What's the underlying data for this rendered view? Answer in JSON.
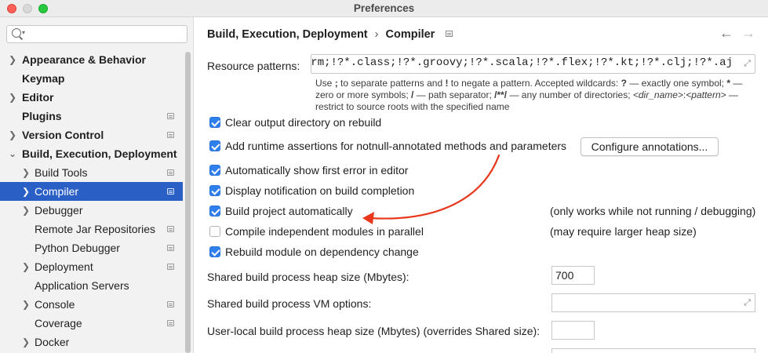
{
  "window": {
    "title": "Preferences"
  },
  "search": {
    "placeholder": "",
    "value": ""
  },
  "sidebar": {
    "items": [
      {
        "label": "Appearance & Behavior"
      },
      {
        "label": "Keymap"
      },
      {
        "label": "Editor"
      },
      {
        "label": "Plugins"
      },
      {
        "label": "Version Control"
      },
      {
        "label": "Build, Execution, Deployment"
      },
      {
        "label": "Build Tools"
      },
      {
        "label": "Compiler"
      },
      {
        "label": "Debugger"
      },
      {
        "label": "Remote Jar Repositories"
      },
      {
        "label": "Python Debugger"
      },
      {
        "label": "Deployment"
      },
      {
        "label": "Application Servers"
      },
      {
        "label": "Console"
      },
      {
        "label": "Coverage"
      },
      {
        "label": "Docker"
      }
    ]
  },
  "breadcrumb": {
    "parent": "Build, Execution, Deployment",
    "separator": "›",
    "current": "Compiler"
  },
  "nav": {
    "back": "←",
    "forward": "→"
  },
  "resource_patterns": {
    "label": "Resource patterns:",
    "value": "!?*.java;!?*.form;!?*.class;!?*.groovy;!?*.scala;!?*.flex;!?*.kt;!?*.clj;!?*.aj",
    "help": {
      "t1": "Use ",
      "b1": ";",
      "t2": " to separate patterns and ",
      "b2": "!",
      "t3": " to negate a pattern. Accepted wildcards: ",
      "b3": "?",
      "t4": " — exactly one symbol; ",
      "b4": "*",
      "t5": " — zero or more symbols; ",
      "b5": "/",
      "t6": " — path separator; ",
      "b6": "/**/",
      "t7": " — any number of directories; ",
      "i1": "<dir_name>",
      "t8": ":",
      "i2": "<pattern>",
      "t9": " — restrict to source roots with the specified name"
    }
  },
  "options": {
    "clear_output": {
      "label": "Clear output directory on rebuild",
      "checked": true
    },
    "runtime_assertions": {
      "label": "Add runtime assertions for notnull-annotated methods and parameters",
      "checked": true
    },
    "configure_button": "Configure annotations...",
    "show_first_error": {
      "label": "Automatically show first error in editor",
      "checked": true
    },
    "display_notification": {
      "label": "Display notification on build completion",
      "checked": true
    },
    "build_auto": {
      "label": "Build project automatically",
      "checked": true,
      "note": "(only works while not running / debugging)"
    },
    "compile_parallel": {
      "label": "Compile independent modules in parallel",
      "checked": false,
      "note": "(may require larger heap size)"
    },
    "rebuild_module": {
      "label": "Rebuild module on dependency change",
      "checked": true
    }
  },
  "heap": {
    "label": "Shared build process heap size (Mbytes):",
    "value": "700"
  },
  "vm_options": {
    "label": "Shared build process VM options:",
    "value": ""
  },
  "user_heap": {
    "label": "User-local build process heap size (Mbytes) (overrides Shared size):",
    "value": ""
  },
  "colors": {
    "accent": "#2a5fc6",
    "checkbox": "#2f80ed",
    "annotation_arrow": "#e8371c"
  }
}
